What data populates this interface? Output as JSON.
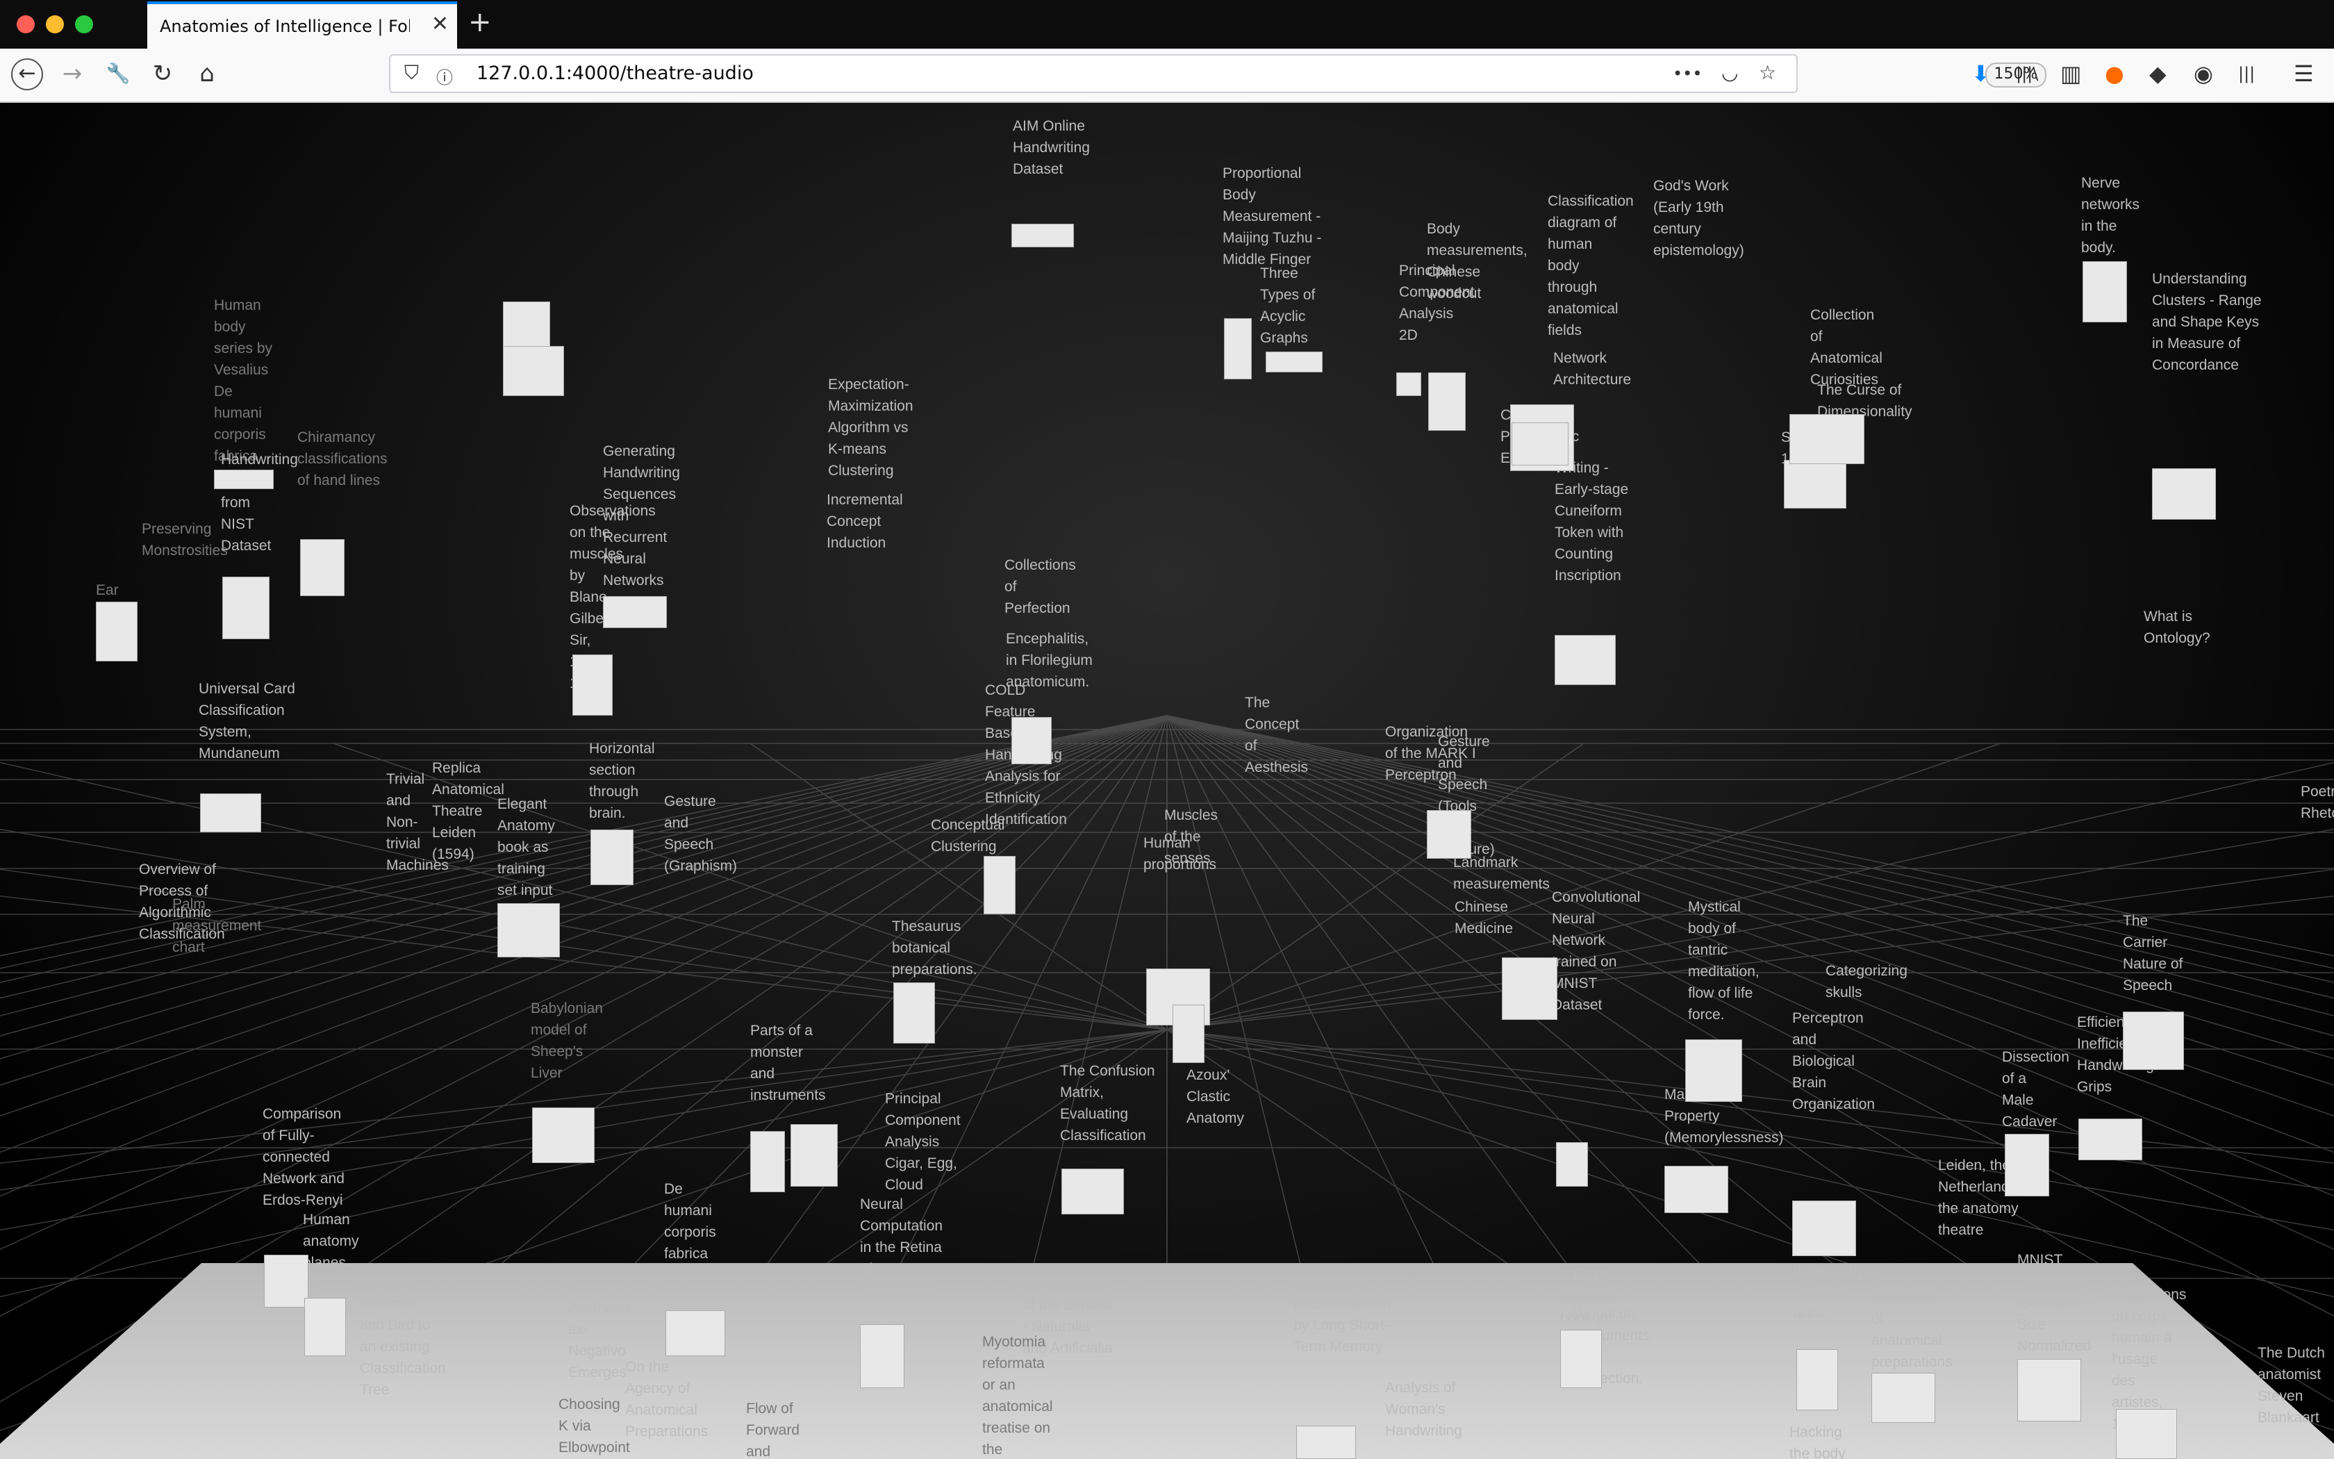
{
  "window": {
    "traffic_lights": [
      "#fe5f57",
      "#febc2e",
      "#28c840"
    ]
  },
  "tabs": [
    {
      "title": "Anatomies of Intelligence | Following",
      "close_glyph": "✕"
    }
  ],
  "new_tab_glyph": "+",
  "navigation": {
    "back_glyph": "←",
    "forward_glyph": "→",
    "tools_glyph": "🔧",
    "reload_glyph": "↻",
    "home_glyph": "⌂",
    "url": "127.0.0.1:4000/theatre-audio",
    "zoom": "150%",
    "more_glyph": "•••",
    "pocket_glyph": "◡",
    "bookmark_glyph": "☆",
    "toolbar_icons": [
      "download-icon",
      "library-icon",
      "sidebar-icon",
      "extension-orange-icon",
      "bird-icon",
      "account-icon",
      "columns-icon",
      "menu-icon"
    ],
    "toolbar_glyphs": [
      "⬇",
      "|||\\",
      "▥",
      "●",
      "◆",
      "◉",
      "|||",
      "☰"
    ],
    "download_color": "#0a84ff"
  },
  "nodes": [
    {
      "text": "Human body series by Vesalius De humani corporis fabrica",
      "dim": true
    },
    {
      "text": "Handwriting Form from NIST Dataset"
    },
    {
      "text": "Chiramancy classifications of hand lines",
      "dim": true
    },
    {
      "text": "Preserving Monstrosities",
      "dim": true
    },
    {
      "text": "Ear",
      "dim": true
    },
    {
      "text": "Universal Card Classification System, Mundaneum"
    },
    {
      "text": "Overview of Process of Algorithmic Classification"
    },
    {
      "text": "Palm measurement chart",
      "dim": true
    },
    {
      "text": "Trivial and Non-trivial Machines"
    },
    {
      "text": "Replica Anatomical Theatre Leiden (1594)"
    },
    {
      "text": "Elegant Anatomy book as training set input"
    },
    {
      "text": "Horizontal section through brain."
    },
    {
      "text": "Gesture and Speech (Graphism)"
    },
    {
      "text": "Generating Handwriting Sequences with Recurrent Neural Networks"
    },
    {
      "text": "Observations on the muscles by Blane Gilbert Sir, 1749-1834."
    },
    {
      "text": "Expectation-Maximization Algorithm vs K-means Clustering"
    },
    {
      "text": "Incremental Concept Induction"
    },
    {
      "text": "Collections of Perfection"
    },
    {
      "text": "Encephalitis, in Florilegium anatomicum."
    },
    {
      "text": "COLD Feature Based Handwriting Analysis for Ethnicity Identification"
    },
    {
      "text": "Conceptual Clustering"
    },
    {
      "text": "Thesaurus botanical preparations."
    },
    {
      "text": "Babylonian model of Sheep's Liver",
      "dim": true
    },
    {
      "text": "Comparison of Fully-connected Network and Erdos-Renyi"
    },
    {
      "text": "Human anatomy planes"
    },
    {
      "text": "Adding Mammal and Bird to an existing Classification Tree"
    },
    {
      "text": "An Aesthesis ex-Negativo Emerges"
    },
    {
      "text": "On the Agency of Anatomical Preparations"
    },
    {
      "text": "De humani corporis fabrica"
    },
    {
      "text": "Parts of a monster and instruments"
    },
    {
      "text": "Principal Component Analysis Cigar, Egg, Cloud"
    },
    {
      "text": "Neural Computation in the Retina of Vertibrates"
    },
    {
      "text": "The Confusion Matrix, Evaluating Classification"
    },
    {
      "text": "Investigation of the Senses - Naturalia and Artificialia"
    },
    {
      "text": "Myotomia reformata or an anatomical treatise on the muscles",
      "dim": true
    },
    {
      "text": "Flow of Forward and Backward",
      "dim": true
    },
    {
      "text": "Choosing K via Elbowpoint",
      "dim": true
    },
    {
      "text": "Proportional Body Measurement - Maijing Tuzhu - Middle Finger"
    },
    {
      "text": "Three Types of Acyclic Graphs"
    },
    {
      "text": "Principal Component Analysis 2D"
    },
    {
      "text": "Body measurements, Chinese woodcut"
    },
    {
      "text": "Classical Probabilistic Examples"
    },
    {
      "text": "Network Architecture"
    },
    {
      "text": "Classification diagram of human body through anatomical fields"
    },
    {
      "text": "God's Work (Early 19th century epistemology)"
    },
    {
      "text": "Writing - Early-stage Cuneiform Token with Counting Inscription"
    },
    {
      "text": "Collection of Anatomical Curiosities"
    },
    {
      "text": "The Curse of Dimensionality"
    },
    {
      "text": "Skull, 1824"
    },
    {
      "text": "AIM Online Handwriting Dataset"
    },
    {
      "text": "Nerve networks in the body."
    },
    {
      "text": "Understanding Clusters - Range and Shape Keys in Measure of Concordance"
    },
    {
      "text": "What is Ontology?"
    },
    {
      "text": "The Concept of Aesthesis"
    },
    {
      "text": "Organization of the MARK I Perceptron"
    },
    {
      "text": "Gesture and Speech (Tools and Gesture)"
    },
    {
      "text": "Landmark measurements"
    },
    {
      "text": "Chinese Medicine"
    },
    {
      "text": "Muscles of the senses"
    },
    {
      "text": "Human proportions"
    },
    {
      "text": "Azoux' Clastic Anatomy"
    },
    {
      "text": "Convolutional Neural Network trained on MNIST Dataset"
    },
    {
      "text": "Mystical body of tantric meditation, flow of life force."
    },
    {
      "text": "Categorizing skulls"
    },
    {
      "text": "Perceptron and Biological Brain Organization"
    },
    {
      "text": "Markov Property (Memorylessness)"
    },
    {
      "text": "Efficient and Inefficient Handwriting Grips"
    },
    {
      "text": "The Carrier Nature of Speech"
    },
    {
      "text": "Dissection of a Male Cadaver"
    },
    {
      "text": "Leiden, the Netherlands, the anatomy theatre"
    },
    {
      "text": "MNIST Database Examples - Size Normalized"
    },
    {
      "text": "Collection of anatomical preparations"
    },
    {
      "text": "drawing by a Persian artist."
    },
    {
      "text": "C17/18 Chinese book art"
    },
    {
      "text": "Woodcut, instruments for dissection."
    },
    {
      "text": "Sine Wave Reconstruction by Long Short-Term Memory"
    },
    {
      "text": "Analysis of Woman's Handwriting"
    },
    {
      "text": "Hacking the body"
    },
    {
      "text": "Proportions du corps humain à l'usage des artistes, 1830"
    },
    {
      "text": "The Dutch anatomist Steven Blankaart"
    },
    {
      "text": "Poetry Rhetoric"
    }
  ]
}
